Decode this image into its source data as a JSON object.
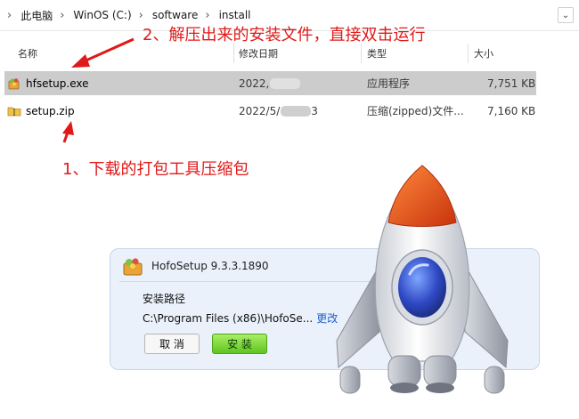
{
  "breadcrumb": [
    "此电脑",
    "WinOS (C:)",
    "software",
    "install"
  ],
  "columns": {
    "name": "名称",
    "modified": "修改日期",
    "type": "类型",
    "size": "大小"
  },
  "files": [
    {
      "name": "hfsetup.exe",
      "modified": "2022,",
      "type": "应用程序",
      "size": "7,751 KB"
    },
    {
      "name": "setup.zip",
      "modified": "2022/5/",
      "modified_end": "3",
      "type": "压缩(zipped)文件...",
      "size": "7,160 KB"
    }
  ],
  "annotations": {
    "step1": "1、下载的打包工具压缩包",
    "step2": "2、解压出来的安装文件，直接双击运行"
  },
  "dialog": {
    "title": "HofoSetup 9.3.3.1890",
    "path_label": "安装路径",
    "path_value": "C:\\Program Files (x86)\\HofoSe...",
    "change_link": "更改",
    "cancel_button": "取 消",
    "install_button": "安 装"
  },
  "colors": {
    "annotation": "#e01818",
    "install_button": "#6cd02a",
    "link": "#1e5fd0",
    "selection": "#cccccc"
  }
}
